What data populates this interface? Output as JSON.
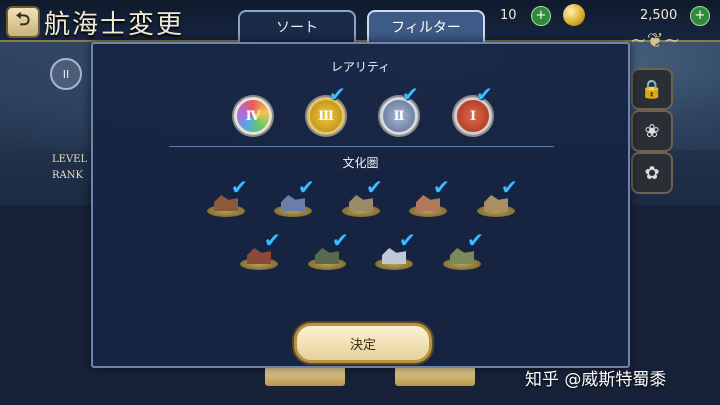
{
  "header": {
    "title": "航海士変更",
    "back_icon": "back-arrow-icon",
    "tabs": [
      {
        "label": "ソート",
        "active": false
      },
      {
        "label": "フィルター",
        "active": true
      }
    ],
    "resources": [
      {
        "value": "10",
        "icon": "green-plus-icon"
      },
      {
        "value": "2,500",
        "icon": "gold-coin-icon"
      }
    ]
  },
  "background": {
    "card_left_level": "LEVEL",
    "card_left_rank": "RANK",
    "side_buttons": [
      "lock-icon",
      "rose-icon",
      "plant-icon"
    ]
  },
  "filter_modal": {
    "rarity_title": "レアリティ",
    "rarity_options": [
      {
        "label": "Ⅳ",
        "checked": false,
        "color": "#rainbow"
      },
      {
        "label": "Ⅲ",
        "checked": true,
        "color": "#f0c73e"
      },
      {
        "label": "Ⅱ",
        "checked": true,
        "color": "#8a9bbb"
      },
      {
        "label": "Ⅰ",
        "checked": true,
        "color": "#c9442a"
      }
    ],
    "culture_title": "文化圏",
    "culture_options": [
      {
        "icon": "culture-town-1-icon",
        "checked": true
      },
      {
        "icon": "culture-town-2-icon",
        "checked": true
      },
      {
        "icon": "culture-town-3-icon",
        "checked": true
      },
      {
        "icon": "culture-town-4-icon",
        "checked": true
      },
      {
        "icon": "culture-town-5-icon",
        "checked": true
      },
      {
        "icon": "culture-town-6-icon",
        "checked": true
      },
      {
        "icon": "culture-town-7-icon",
        "checked": true
      },
      {
        "icon": "culture-town-8-icon",
        "checked": true
      },
      {
        "icon": "culture-town-9-icon",
        "checked": true
      }
    ],
    "confirm_label": "決定"
  },
  "watermark": "知乎 @威斯特蜀黍",
  "colors": {
    "check": "#3fbcff",
    "modal_bg": "#162442",
    "gold": "#b89347"
  }
}
